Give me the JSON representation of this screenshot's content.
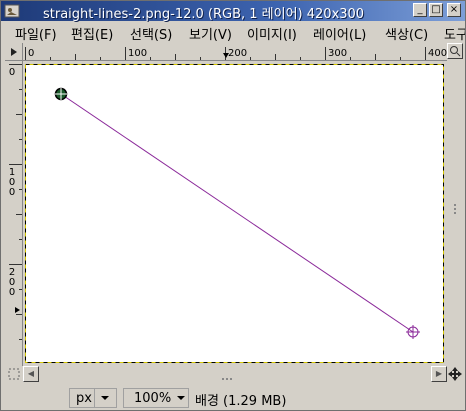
{
  "window": {
    "title": "straight-lines-2.png-12.0 (RGB, 1 레이어) 420x300"
  },
  "menu": {
    "items": [
      "파일(F)",
      "편집(E)",
      "선택(S)",
      "보기(V)",
      "이미지(I)",
      "레이어(L)",
      "색상(C)",
      "도구"
    ]
  },
  "rulers": {
    "horizontal_labels": [
      "0",
      "100",
      "200",
      "300",
      "400"
    ],
    "vertical_labels": [
      "0",
      "100",
      "200"
    ]
  },
  "canvas": {
    "image_width": 420,
    "image_height": 300,
    "line_color": "#8b2a9a",
    "line_start": [
      36,
      30
    ],
    "line_end": [
      388,
      268
    ]
  },
  "status": {
    "unit": "px",
    "zoom": "100%",
    "info": "배경 (1.29 MB)"
  },
  "colors": {
    "titlebar_start": "#1e3a78",
    "titlebar_end": "#7d9fd8",
    "selection_dash": "#d6c800"
  }
}
